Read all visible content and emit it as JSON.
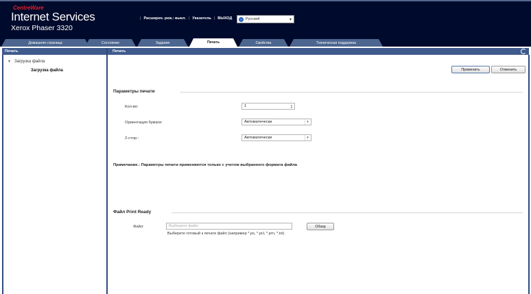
{
  "header": {
    "brand_small": "CentreWare",
    "brand_title": "Internet Services",
    "model": "Xerox Phaser 3320",
    "links": [
      "Расширен. реж.: выкл.",
      "Указатель",
      "ВЫХОД"
    ],
    "language": "Русский"
  },
  "tabs": [
    {
      "label": "Домашняя страница",
      "active": false
    },
    {
      "label": "Состояние",
      "active": false
    },
    {
      "label": "Задания",
      "active": false
    },
    {
      "label": "Печать",
      "active": true
    },
    {
      "label": "Свойства",
      "active": false
    },
    {
      "label": "Техническая поддержка",
      "active": false
    }
  ],
  "sidebar": {
    "heading": "Печать",
    "parent": "Загрузка файла",
    "child": "Загрузка файла"
  },
  "main": {
    "heading": "Печать",
    "apply_label": "Применить",
    "cancel_label": "Отменить",
    "print_params": {
      "title": "Параметры печати",
      "copies_label": "Кол-во:",
      "copies_value": "1",
      "orientation_label": "Ориентация бумаги:",
      "orientation_value": "Автоматически",
      "duplex_label": "2-стор.:",
      "duplex_value": "Автоматически"
    },
    "note": "Примечание.: Параметры печати применяются только с учетом выбранного формата файла",
    "print_ready": {
      "title": "Файл Print Ready",
      "file_label": "Файл:",
      "file_placeholder": "Выберите файл",
      "browse_label": "Обзор",
      "hint": "Выберите готовый к печати файл (например *.ps, *.pcl, *.prn, *.txt)"
    }
  },
  "colors": {
    "header_bg": "#000a2c",
    "tab_bg": "#4d6690",
    "subheader_bg": "#3f5a8c",
    "brand_red": "#e0202a"
  }
}
